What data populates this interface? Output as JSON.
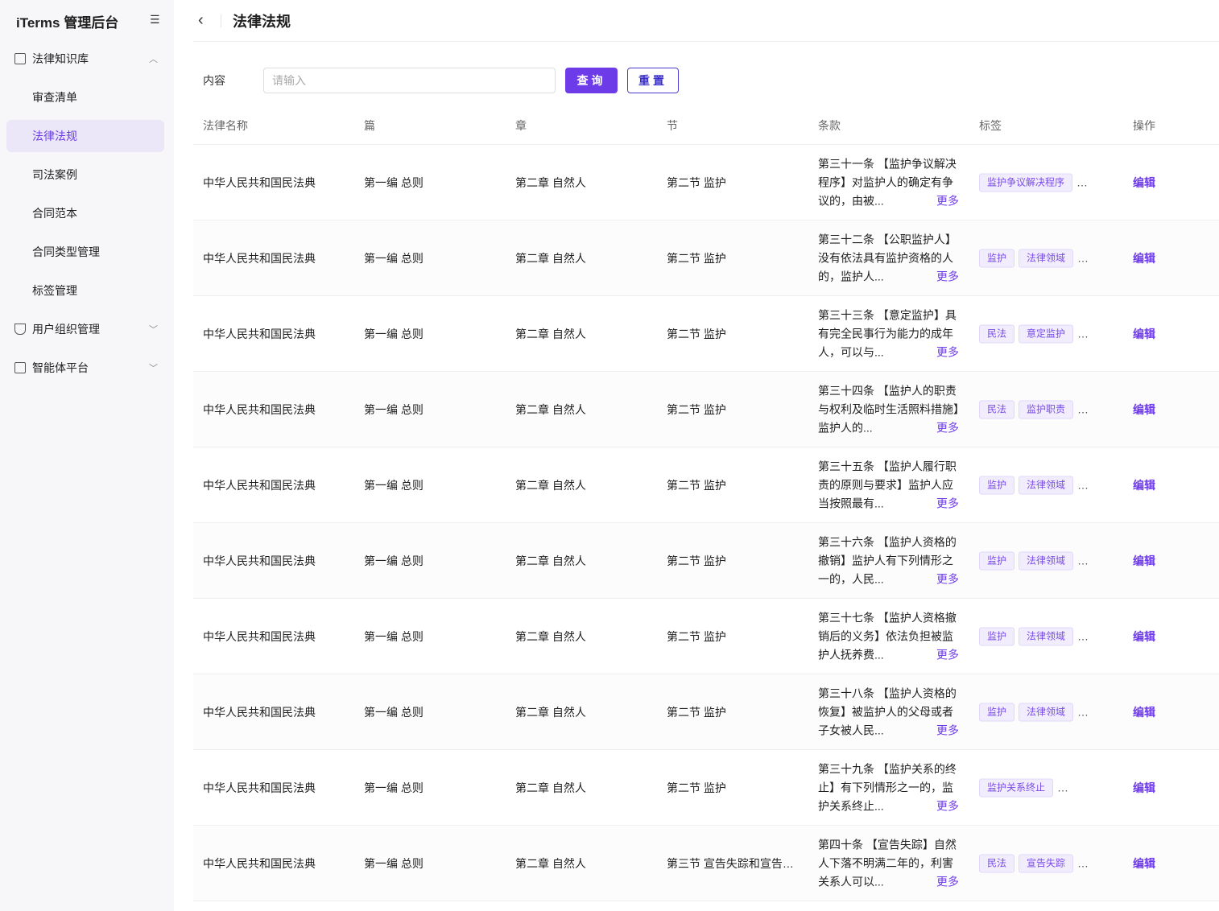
{
  "sidebar": {
    "brand": "iTerms 管理后台",
    "groups": [
      {
        "label": "法律知识库",
        "items": [
          "审查清单",
          "法律法规",
          "司法案例",
          "合同范本",
          "合同类型管理",
          "标签管理"
        ]
      },
      {
        "label": "用户组织管理"
      },
      {
        "label": "智能体平台"
      }
    ]
  },
  "header": {
    "title": "法律法规"
  },
  "filter": {
    "label": "内容",
    "placeholder": "请输入",
    "query": "查询",
    "reset": "重置"
  },
  "table": {
    "columns": [
      "法律名称",
      "篇",
      "章",
      "节",
      "条款",
      "标签",
      "操作"
    ],
    "more": "更多",
    "edit": "编辑",
    "dots": "…",
    "rows": [
      {
        "law": "中华人民共和国民法典",
        "part": "第一编 总则",
        "chapter": "第二章 自然人",
        "section": "第二节 监护",
        "clause": "第三十一条 【监护争议解决程序】对监护人的确定有争议的，由被...",
        "tags": [
          "监护争议解决程序"
        ]
      },
      {
        "law": "中华人民共和国民法典",
        "part": "第一编 总则",
        "chapter": "第二章 自然人",
        "section": "第二节 监护",
        "clause": "第三十二条 【公职监护人】没有依法具有监护资格的人的，监护人...",
        "tags": [
          "监护",
          "法律领域"
        ]
      },
      {
        "law": "中华人民共和国民法典",
        "part": "第一编 总则",
        "chapter": "第二章 自然人",
        "section": "第二节 监护",
        "clause": "第三十三条 【意定监护】具有完全民事行为能力的成年人，可以与...",
        "tags": [
          "民法",
          "意定监护"
        ]
      },
      {
        "law": "中华人民共和国民法典",
        "part": "第一编 总则",
        "chapter": "第二章 自然人",
        "section": "第二节 监护",
        "clause": "第三十四条 【监护人的职责与权利及临时生活照料措施】监护人的...",
        "tags": [
          "民法",
          "监护职责"
        ]
      },
      {
        "law": "中华人民共和国民法典",
        "part": "第一编 总则",
        "chapter": "第二章 自然人",
        "section": "第二节 监护",
        "clause": "第三十五条 【监护人履行职责的原则与要求】监护人应当按照最有...",
        "tags": [
          "监护",
          "法律领域"
        ]
      },
      {
        "law": "中华人民共和国民法典",
        "part": "第一编 总则",
        "chapter": "第二章 自然人",
        "section": "第二节 监护",
        "clause": "第三十六条 【监护人资格的撤销】监护人有下列情形之一的，人民...",
        "tags": [
          "监护",
          "法律领域"
        ]
      },
      {
        "law": "中华人民共和国民法典",
        "part": "第一编 总则",
        "chapter": "第二章 自然人",
        "section": "第二节 监护",
        "clause": "第三十七条 【监护人资格撤销后的义务】依法负担被监护人抚养费...",
        "tags": [
          "监护",
          "法律领域"
        ]
      },
      {
        "law": "中华人民共和国民法典",
        "part": "第一编 总则",
        "chapter": "第二章 自然人",
        "section": "第二节 监护",
        "clause": "第三十八条 【监护人资格的恢复】被监护人的父母或者子女被人民...",
        "tags": [
          "监护",
          "法律领域"
        ]
      },
      {
        "law": "中华人民共和国民法典",
        "part": "第一编 总则",
        "chapter": "第二章 自然人",
        "section": "第二节 监护",
        "clause": "第三十九条 【监护关系的终止】有下列情形之一的，监护关系终止...",
        "tags": [
          "监护关系终止"
        ]
      },
      {
        "law": "中华人民共和国民法典",
        "part": "第一编 总则",
        "chapter": "第二章 自然人",
        "section": "第三节 宣告失踪和宣告死亡",
        "clause": "第四十条 【宣告失踪】自然人下落不明满二年的，利害关系人可以...",
        "tags": [
          "民法",
          "宣告失踪"
        ]
      }
    ]
  }
}
